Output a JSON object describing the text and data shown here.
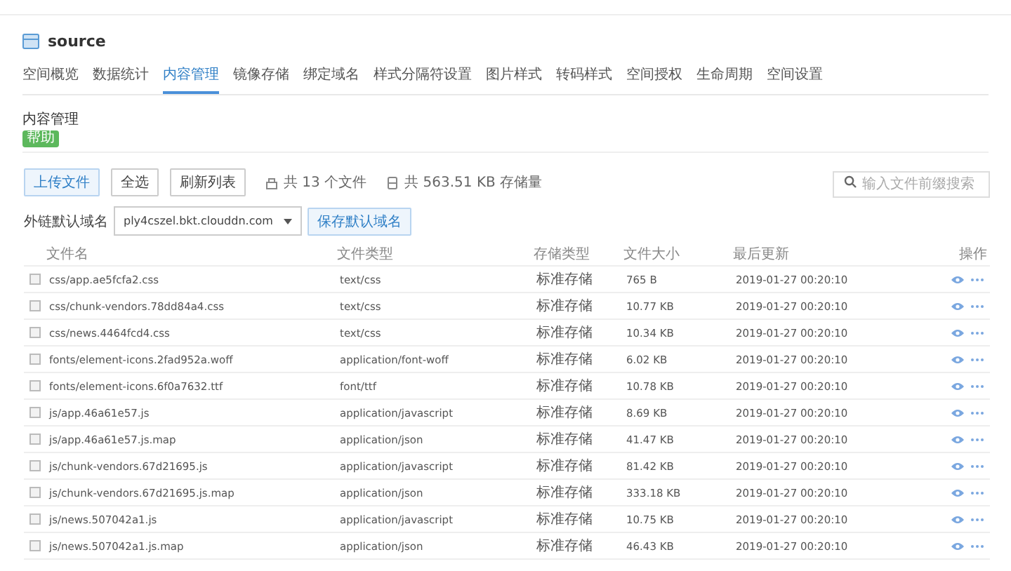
{
  "bucket": {
    "title": "source"
  },
  "tabs": [
    {
      "label": "空间概览",
      "selected": false
    },
    {
      "label": "数据统计",
      "selected": false
    },
    {
      "label": "内容管理",
      "selected": true
    },
    {
      "label": "镜像存储",
      "selected": false
    },
    {
      "label": "绑定域名",
      "selected": false
    },
    {
      "label": "样式分隔符设置",
      "selected": false
    },
    {
      "label": "图片样式",
      "selected": false
    },
    {
      "label": "转码样式",
      "selected": false
    },
    {
      "label": "空间授权",
      "selected": false
    },
    {
      "label": "生命周期",
      "selected": false
    },
    {
      "label": "空间设置",
      "selected": false
    }
  ],
  "section": {
    "title": "内容管理",
    "badge": "帮助"
  },
  "toolbar": {
    "buttons": [
      "上传文件",
      "全选",
      "刷新列表"
    ],
    "file_count": "共 13 个文件",
    "storage": "共 563.51 KB 存储量",
    "search": {
      "placeholder": "输入文件前缀搜索"
    }
  },
  "domain": {
    "label": "外链默认域名",
    "value": "ply4cszel.bkt.clouddn.com",
    "button": "保存默认域名"
  },
  "table": {
    "columns": [
      "文件名",
      "文件类型",
      "存储类型",
      "文件大小",
      "最后更新",
      "操作"
    ],
    "rows": [
      {
        "checked": false,
        "name": "css/app.ae5fcfa2.css",
        "type": "text/css",
        "storage": "标准存储",
        "size": "765 B",
        "updated": "2019-01-27 00:20:10"
      },
      {
        "checked": false,
        "name": "css/chunk-vendors.78dd84a4.css",
        "type": "text/css",
        "storage": "标准存储",
        "size": "10.77 KB",
        "updated": "2019-01-27 00:20:10"
      },
      {
        "checked": false,
        "name": "css/news.4464fcd4.css",
        "type": "text/css",
        "storage": "标准存储",
        "size": "10.34 KB",
        "updated": "2019-01-27 00:20:10"
      },
      {
        "checked": false,
        "name": "fonts/element-icons.2fad952a.woff",
        "type": "application/font-woff",
        "storage": "标准存储",
        "size": "6.02 KB",
        "updated": "2019-01-27 00:20:10"
      },
      {
        "checked": false,
        "name": "fonts/element-icons.6f0a7632.ttf",
        "type": "font/ttf",
        "storage": "标准存储",
        "size": "10.78 KB",
        "updated": "2019-01-27 00:20:10"
      },
      {
        "checked": false,
        "name": "js/app.46a61e57.js",
        "type": "application/javascript",
        "storage": "标准存储",
        "size": "8.69 KB",
        "updated": "2019-01-27 00:20:10"
      },
      {
        "checked": false,
        "name": "js/app.46a61e57.js.map",
        "type": "application/json",
        "storage": "标准存储",
        "size": "41.47 KB",
        "updated": "2019-01-27 00:20:10"
      },
      {
        "checked": false,
        "name": "js/chunk-vendors.67d21695.js",
        "type": "application/javascript",
        "storage": "标准存储",
        "size": "81.42 KB",
        "updated": "2019-01-27 00:20:10"
      },
      {
        "checked": false,
        "name": "js/chunk-vendors.67d21695.js.map",
        "type": "application/json",
        "storage": "标准存储",
        "size": "333.18 KB",
        "updated": "2019-01-27 00:20:10"
      },
      {
        "checked": false,
        "name": "js/news.507042a1.js",
        "type": "application/javascript",
        "storage": "标准存储",
        "size": "10.75 KB",
        "updated": "2019-01-27 00:20:10"
      },
      {
        "checked": false,
        "name": "js/news.507042a1.js.map",
        "type": "application/json",
        "storage": "标准存储",
        "size": "46.43 KB",
        "updated": "2019-01-27 00:20:10"
      }
    ]
  }
}
